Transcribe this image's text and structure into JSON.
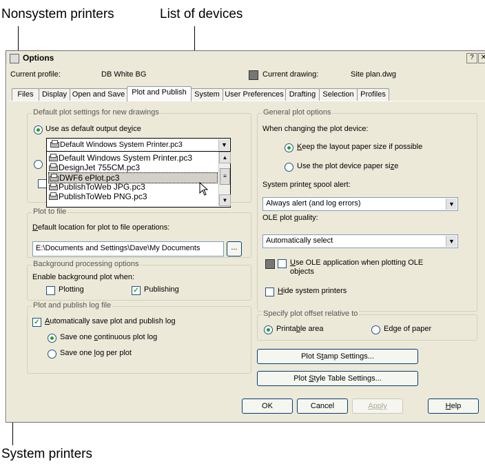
{
  "callouts": {
    "nonsystem": "Nonsystem printers",
    "devices": "List of devices",
    "system": "System printers"
  },
  "dialog": {
    "title": "Options",
    "help_btn": "?",
    "close_btn": "✕",
    "profile_label": "Current profile:",
    "profile_value": "DB White BG",
    "drawing_label": "Current drawing:",
    "drawing_value": "Site plan.dwg"
  },
  "tabs": [
    "Files",
    "Display",
    "Open and Save",
    "Plot and Publish",
    "System",
    "User Preferences",
    "Drafting",
    "Selection",
    "Profiles"
  ],
  "left": {
    "default_group": "Default plot settings for new drawings",
    "use_default_pre": "Use as default output de",
    "use_default_u": "v",
    "use_default_post": "ice",
    "combo_value": "Default Windows System Printer.pc3",
    "devices": [
      "Default Windows System Printer.pc3",
      "DesignJet 755CM.pc3",
      "DWF6 ePlot.pc3",
      "PublishToWeb JPG.pc3",
      "PublishToWeb PNG.pc3"
    ],
    "plot_to_file_group": "Plot to file",
    "default_loc_u": "D",
    "default_loc_post": "efault location for plot to file operations:",
    "file_path": "E:\\Documents and Settings\\Dave\\My Documents",
    "browse": "...",
    "bg_group": "Background processing options",
    "enable_bg": "Enable background plot when:",
    "plotting": "Plotting",
    "publishing": "Publishing",
    "log_group": "Plot and publish log file",
    "auto_save_u": "A",
    "auto_save_post": "utomatically save plot and publish log",
    "continuous_pre": "Save one ",
    "continuous_u": "c",
    "continuous_post": "ontinuous plot log",
    "per_plot_pre": "Save one ",
    "per_plot_u": "l",
    "per_plot_post": "og per plot"
  },
  "right": {
    "general_group": "General plot options",
    "changing_label": "When changing the plot device:",
    "keep_u": "K",
    "keep_post": "eep the layout paper size if possible",
    "use_device_pre": "Use the plot device paper si",
    "use_device_u": "z",
    "use_device_post": "e",
    "spool_pre": "System printe",
    "spool_u": "r",
    "spool_post": " spool alert:",
    "spool_value": "Always alert (and log errors)",
    "ole_quality_pre": "OLE plot ",
    "ole_quality_u": "q",
    "ole_quality_post": "uality:",
    "ole_quality_value": "Automatically select",
    "use_ole_u": "U",
    "use_ole_post": "se OLE application when plotting OLE",
    "use_ole_line2": "objects",
    "hide_u": "H",
    "hide_post": "ide system printers",
    "offset_group": "Specify plot offset relative to",
    "printable_pre": "Printa",
    "printable_u": "b",
    "printable_post": "le area",
    "edge_pre": "Ed",
    "edge_u": "g",
    "edge_post": "e of paper",
    "stamp_pre": "Plot S",
    "stamp_u": "t",
    "stamp_post": "amp Settings...",
    "style_pre": "Plot ",
    "style_u": "S",
    "style_post": "tyle Table Settings..."
  },
  "buttons": {
    "ok": "OK",
    "cancel": "Cancel",
    "apply": "Apply",
    "help": "Help"
  }
}
